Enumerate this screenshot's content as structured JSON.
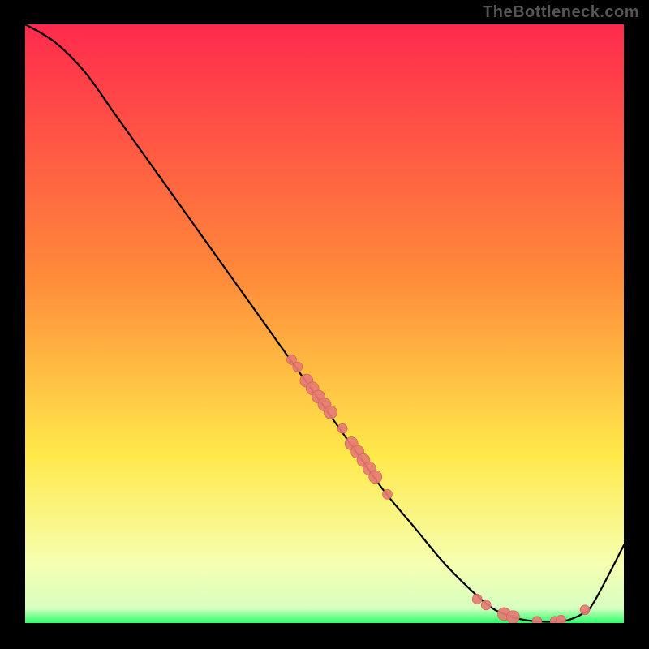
{
  "watermark": "TheBottleneck.com",
  "colors": {
    "bg": "#000000",
    "grad_top": "#ff2a4d",
    "grad_mid1": "#ff8a3a",
    "grad_mid2": "#ffe94a",
    "grad_mid3": "#f6ffb0",
    "grad_bot": "#2aff6a",
    "curve": "#000000",
    "marker_fill": "#e77b74",
    "marker_stroke": "#c85a52"
  },
  "chart_data": {
    "type": "line",
    "x": [
      0,
      0.05,
      0.1,
      0.15,
      0.2,
      0.25,
      0.3,
      0.35,
      0.4,
      0.45,
      0.5,
      0.55,
      0.6,
      0.65,
      0.7,
      0.75,
      0.78,
      0.8,
      0.82,
      0.85,
      0.88,
      0.9,
      0.93,
      0.95,
      1.0
    ],
    "y": [
      1.0,
      0.97,
      0.92,
      0.85,
      0.78,
      0.71,
      0.64,
      0.57,
      0.5,
      0.43,
      0.36,
      0.29,
      0.22,
      0.16,
      0.1,
      0.05,
      0.025,
      0.015,
      0.008,
      0.003,
      0.002,
      0.003,
      0.015,
      0.035,
      0.13
    ],
    "xlim": [
      0,
      1
    ],
    "ylim": [
      0,
      1
    ],
    "title": "",
    "xlabel": "",
    "ylabel": "",
    "markers": [
      {
        "x": 0.445,
        "y": 0.44,
        "r": 6
      },
      {
        "x": 0.455,
        "y": 0.428,
        "r": 6
      },
      {
        "x": 0.47,
        "y": 0.405,
        "r": 8
      },
      {
        "x": 0.48,
        "y": 0.392,
        "r": 8
      },
      {
        "x": 0.49,
        "y": 0.378,
        "r": 8
      },
      {
        "x": 0.5,
        "y": 0.365,
        "r": 8
      },
      {
        "x": 0.51,
        "y": 0.352,
        "r": 8
      },
      {
        "x": 0.53,
        "y": 0.325,
        "r": 6
      },
      {
        "x": 0.545,
        "y": 0.3,
        "r": 8
      },
      {
        "x": 0.555,
        "y": 0.286,
        "r": 8
      },
      {
        "x": 0.565,
        "y": 0.272,
        "r": 8
      },
      {
        "x": 0.575,
        "y": 0.258,
        "r": 8
      },
      {
        "x": 0.585,
        "y": 0.244,
        "r": 8
      },
      {
        "x": 0.605,
        "y": 0.215,
        "r": 6
      },
      {
        "x": 0.755,
        "y": 0.04,
        "r": 6
      },
      {
        "x": 0.77,
        "y": 0.03,
        "r": 6
      },
      {
        "x": 0.8,
        "y": 0.015,
        "r": 8
      },
      {
        "x": 0.815,
        "y": 0.01,
        "r": 8
      },
      {
        "x": 0.855,
        "y": 0.003,
        "r": 6
      },
      {
        "x": 0.885,
        "y": 0.003,
        "r": 6
      },
      {
        "x": 0.895,
        "y": 0.005,
        "r": 6
      },
      {
        "x": 0.935,
        "y": 0.022,
        "r": 6
      }
    ],
    "gradient_stops": [
      {
        "offset": 0.0,
        "color": "#ff2a4d"
      },
      {
        "offset": 0.42,
        "color": "#ff8a3a"
      },
      {
        "offset": 0.72,
        "color": "#ffe94a"
      },
      {
        "offset": 0.9,
        "color": "#f6ffb0"
      },
      {
        "offset": 0.975,
        "color": "#d8ffc0"
      },
      {
        "offset": 1.0,
        "color": "#2aff6a"
      }
    ]
  }
}
